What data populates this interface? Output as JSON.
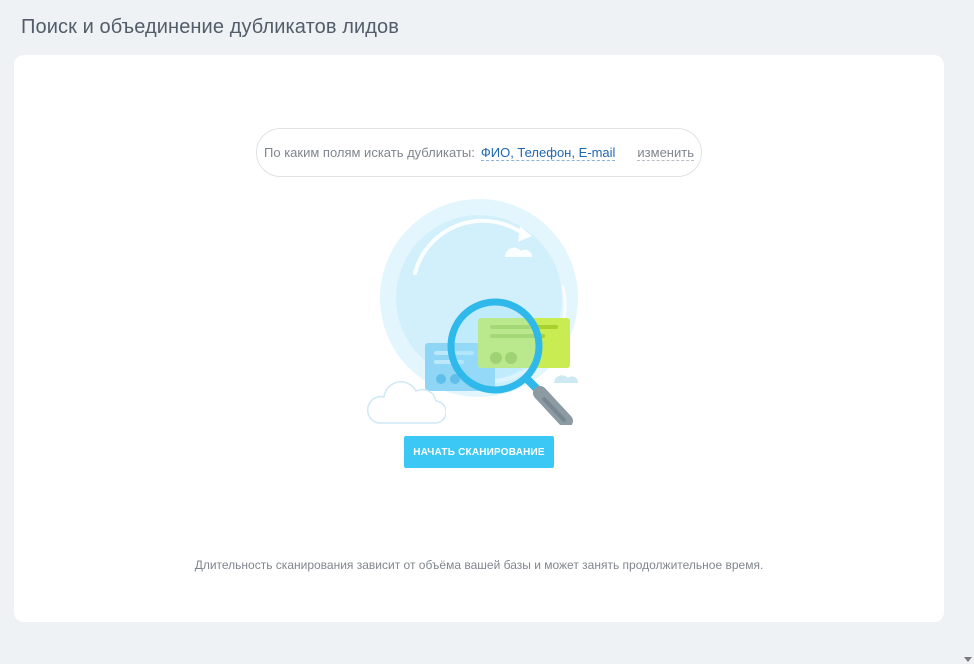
{
  "header": {
    "title": "Поиск и объединение дубликатов лидов"
  },
  "search_fields": {
    "label": "По каким полям искать дубликаты:",
    "fields_value": "ФИО, Телефон, E-mail",
    "change_label": "изменить"
  },
  "scan": {
    "button_label": "НАЧАТЬ СКАНИРОВАНИЕ",
    "hint": "Длительность сканирования зависит от объёма вашей базы и может занять продолжительное время."
  },
  "colors": {
    "page_bg": "#eef2f4",
    "card_bg": "#ffffff",
    "accent_button": "#3bc8f5",
    "link": "#2067b0",
    "text_muted": "#80868e",
    "title": "#535c69"
  },
  "icons": {
    "illustration": "magnifier-duplicate-cards-illustration",
    "scroll": "scroll-down-arrow-icon"
  }
}
